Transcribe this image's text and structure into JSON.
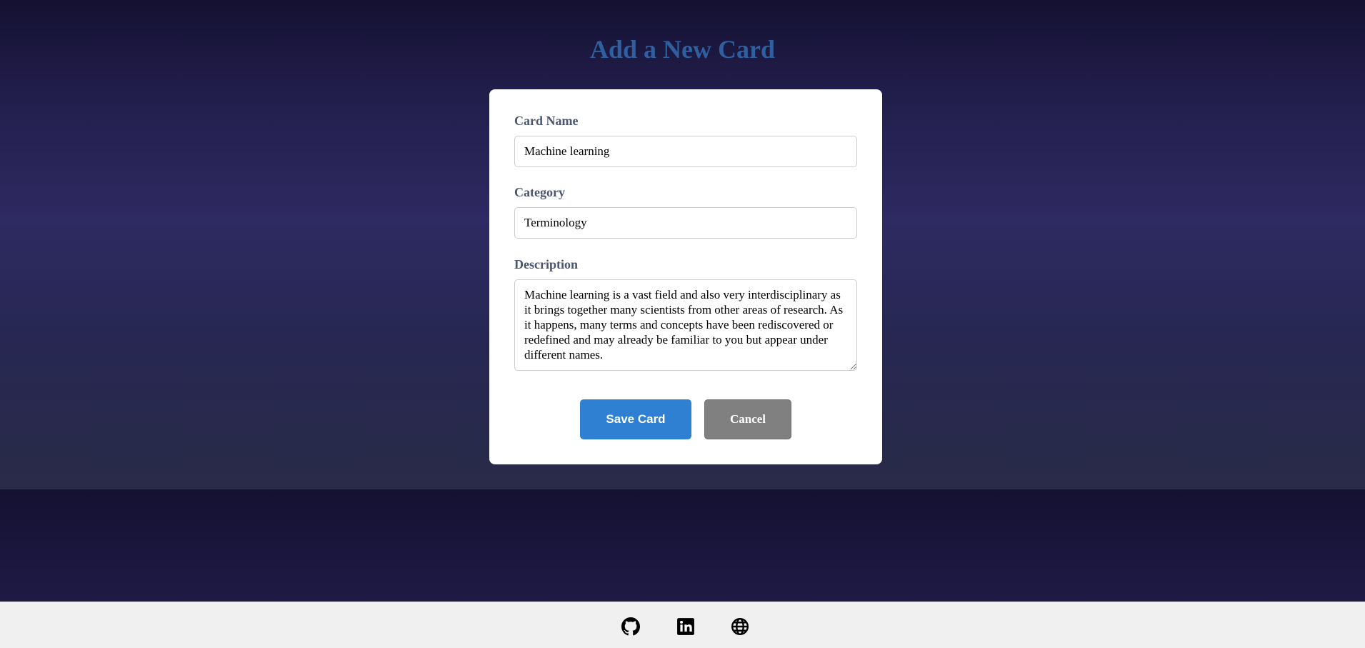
{
  "page": {
    "title": "Add a New Card"
  },
  "form": {
    "card_name": {
      "label": "Card Name",
      "value": "Machine learning"
    },
    "category": {
      "label": "Category",
      "value": "Terminology"
    },
    "description": {
      "label": "Description",
      "value": "Machine learning is a vast field and also very interdisciplinary as it brings together many scientists from other areas of research. As it happens, many terms and concepts have been rediscovered or redefined and may already be familiar to you but appear under different names."
    },
    "save_label": "Save Card",
    "cancel_label": "Cancel"
  },
  "footer": {
    "icons": [
      "github-icon",
      "linkedin-icon",
      "globe-icon"
    ]
  },
  "colors": {
    "title": "#2f5f9f",
    "save_button": "#2f7fd3",
    "cancel_button": "#808080",
    "card_background": "#ffffff",
    "footer_background": "#f0f0f0"
  }
}
